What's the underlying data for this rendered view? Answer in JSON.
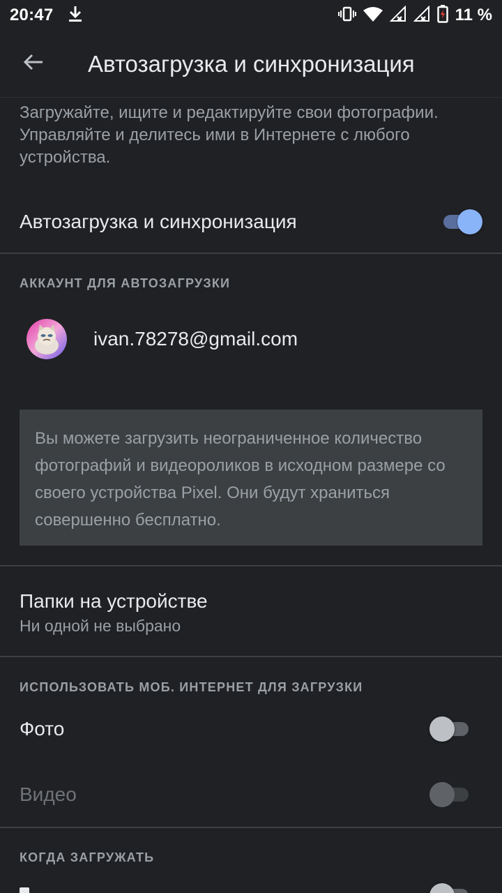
{
  "status_bar": {
    "time": "20:47",
    "battery_percent": "11 %",
    "icons": [
      "download-icon",
      "vibrate-icon",
      "wifi-icon",
      "signal-icon",
      "signal-icon",
      "battery-charging-icon"
    ]
  },
  "toolbar": {
    "title": "Автозагрузка и синхронизация"
  },
  "description": "Загружайте, ищите и редактируйте свои фотографии. Управляйте и делитесь ими в Интернете с любого устройства.",
  "main_toggle": {
    "label": "Автозагрузка и синхронизация",
    "checked": true
  },
  "account_section": {
    "header": "АККАУНТ ДЛЯ АВТОЗАГРУЗКИ",
    "email": "ivan.78278@gmail.com"
  },
  "info_text": "Вы можете загрузить неограниченное количество фотографий и видеороликов в исходном размере со своего устройства Pixel. Они будут храниться совершенно бесплатно.",
  "device_folders": {
    "title": "Папки на устройстве",
    "subtitle": "Ни одной не выбрано"
  },
  "mobile_data_section": {
    "header": "ИСПОЛЬЗОВАТЬ МОБ. ИНТЕРНЕТ ДЛЯ ЗАГРУЗКИ",
    "photo_label": "Фото",
    "photo_checked": false,
    "video_label": "Видео",
    "video_checked": false,
    "video_enabled": false
  },
  "when_section": {
    "header": "КОГДА ЗАГРУЖАТЬ"
  },
  "colors": {
    "background": "#202124",
    "accent": "#8ab4f8",
    "secondary_text": "#9aa0a6",
    "info_box": "#3c4043"
  }
}
